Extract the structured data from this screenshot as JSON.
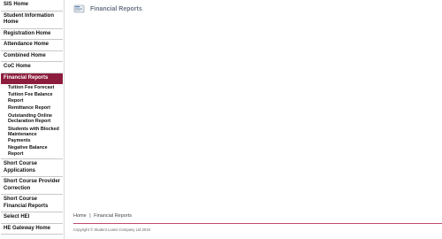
{
  "sidebar": {
    "items": [
      {
        "label": "SIS Home"
      },
      {
        "label": "Student Information Home"
      },
      {
        "label": "Registration Home"
      },
      {
        "label": "Attendance Home"
      },
      {
        "label": "Combined Home"
      },
      {
        "label": "CoC Home"
      },
      {
        "label": "Financial Reports"
      },
      {
        "label": "Short Course Applications"
      },
      {
        "label": "Short Course Provider Correction"
      },
      {
        "label": "Short Course Financial Reports"
      },
      {
        "label": "Select HEI"
      },
      {
        "label": "HE Gateway Home"
      }
    ],
    "sub_items": [
      {
        "label": "Tuition Fee Forecast"
      },
      {
        "label": "Tuition Fee Balance Report"
      },
      {
        "label": "Remittance Report"
      },
      {
        "label": "Outstanding Online Declaration Report"
      },
      {
        "label": "Students with Blocked Maintenance Payments"
      },
      {
        "label": "Negative Balance Report"
      }
    ]
  },
  "header": {
    "title": "Financial Reports",
    "icon": "report-icon"
  },
  "footer": {
    "home_link": "Home",
    "separator": "|",
    "current": "Financial Reports",
    "copyright": "Copyright © Student Loans Company Ltd 2019"
  },
  "colors": {
    "active_bg": "#8c1d3c",
    "title_color": "#6b7686",
    "footer_rule": "#c04a6b"
  }
}
